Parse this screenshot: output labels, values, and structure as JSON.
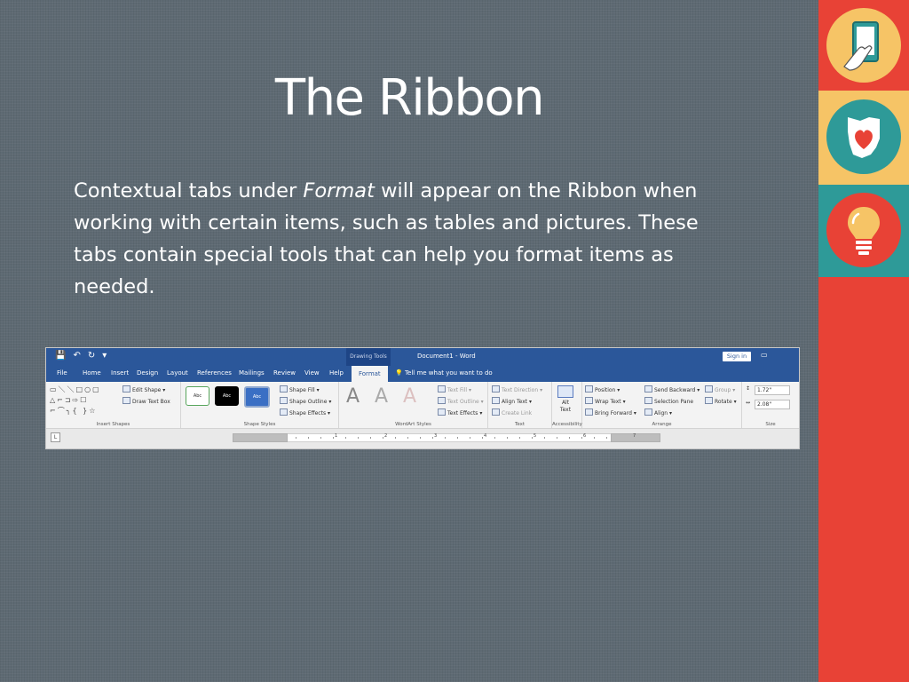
{
  "slide": {
    "title": "The Ribbon",
    "body_before": "Contextual tabs under ",
    "body_italic": "Format",
    "body_after": " will appear on the Ribbon when working with certain items, such as tables and pictures.  These tabs contain special tools that can help you format items as needed."
  },
  "colors": {
    "red": "#e84236",
    "yellow": "#f6c466",
    "teal": "#2e9a98",
    "word_blue": "#2b579a",
    "background": "#5e6a73"
  },
  "sidebar_icons": [
    "tablet-touch-icon",
    "ohio-heart-icon",
    "lightbulb-icon"
  ],
  "ribbon": {
    "context_label": "Drawing Tools",
    "doc_title": "Document1  -  Word",
    "sign_in": "Sign in",
    "tabs": [
      "File",
      "Home",
      "Insert",
      "Design",
      "Layout",
      "References",
      "Mailings",
      "Review",
      "View",
      "Help"
    ],
    "active_tab": "Format",
    "tell_me": "Tell me what you want to do",
    "groups": {
      "insert_shapes": {
        "label": "Insert Shapes",
        "edit_shape": "Edit Shape",
        "draw_text_box": "Draw Text Box"
      },
      "shape_styles": {
        "label": "Shape Styles",
        "style_text": "Abc",
        "shape_fill": "Shape Fill",
        "shape_outline": "Shape Outline",
        "shape_effects": "Shape Effects"
      },
      "wordart": {
        "label": "WordArt Styles",
        "letter": "A",
        "text_fill": "Text Fill",
        "text_outline": "Text Outline",
        "text_effects": "Text Effects"
      },
      "text": {
        "label": "Text",
        "text_direction": "Text Direction",
        "align_text": "Align Text",
        "create_link": "Create Link"
      },
      "accessibility": {
        "label": "Accessibility",
        "alt": "Alt",
        "text": "Text"
      },
      "arrange": {
        "label": "Arrange",
        "position": "Position",
        "wrap_text": "Wrap Text",
        "bring_forward": "Bring Forward",
        "send_backward": "Send Backward",
        "selection_pane": "Selection Pane",
        "align": "Align",
        "group": "Group",
        "rotate": "Rotate"
      },
      "size": {
        "label": "Size",
        "height": "1.72\"",
        "width": "2.08\""
      }
    },
    "ruler_numbers": [
      "1",
      "2",
      "3",
      "4",
      "5",
      "6",
      "7"
    ]
  }
}
